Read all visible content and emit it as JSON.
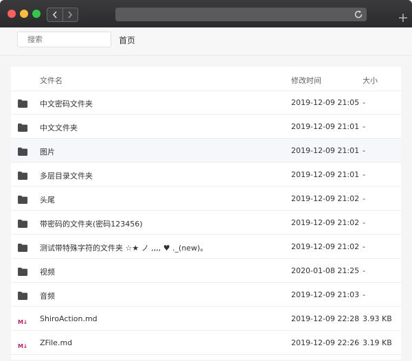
{
  "browser": {
    "back_icon": "chevron-left-icon",
    "forward_icon": "chevron-right-icon",
    "reload_icon": "reload-icon",
    "new_tab_icon": "plus-icon"
  },
  "topbar": {
    "search_placeholder": "搜索",
    "breadcrumb": "首页"
  },
  "table": {
    "headers": {
      "name": "文件名",
      "time": "修改时间",
      "size": "大小"
    },
    "rows": [
      {
        "icon": "folder-icon",
        "name": "中文密码文件夹",
        "time": "2019-12-09 21:05",
        "size": "-"
      },
      {
        "icon": "folder-icon",
        "name": "中文文件夹",
        "time": "2019-12-09 21:01",
        "size": "-"
      },
      {
        "icon": "folder-icon",
        "name": "图片",
        "time": "2019-12-09 21:01",
        "size": "-"
      },
      {
        "icon": "folder-icon",
        "name": "多层目录文件夹",
        "time": "2019-12-09 21:01",
        "size": "-"
      },
      {
        "icon": "folder-icon",
        "name": "头尾",
        "time": "2019-12-09 21:02",
        "size": "-"
      },
      {
        "icon": "folder-icon",
        "name": "带密码的文件夹(密码123456)",
        "time": "2019-12-09 21:02",
        "size": "-"
      },
      {
        "icon": "folder-icon",
        "name": "测试带特殊字符的文件夹 ☆★ ノ ,,,, ♥ ._(new)。",
        "time": "2019-12-09 21:02",
        "size": "-"
      },
      {
        "icon": "folder-icon",
        "name": "视频",
        "time": "2020-01-08 21:25",
        "size": "-"
      },
      {
        "icon": "folder-icon",
        "name": "音频",
        "time": "2019-12-09 21:03",
        "size": "-"
      },
      {
        "icon": "markdown-icon",
        "name": "ShiroAction.md",
        "time": "2019-12-09 22:28",
        "size": "3.93 KB"
      },
      {
        "icon": "markdown-icon",
        "name": "ZFile.md",
        "time": "2019-12-09 22:26",
        "size": "3.19 KB"
      }
    ],
    "hovered_row": 2,
    "markdown_icon_text": "M↓",
    "markdown_color": "#b8226b"
  }
}
